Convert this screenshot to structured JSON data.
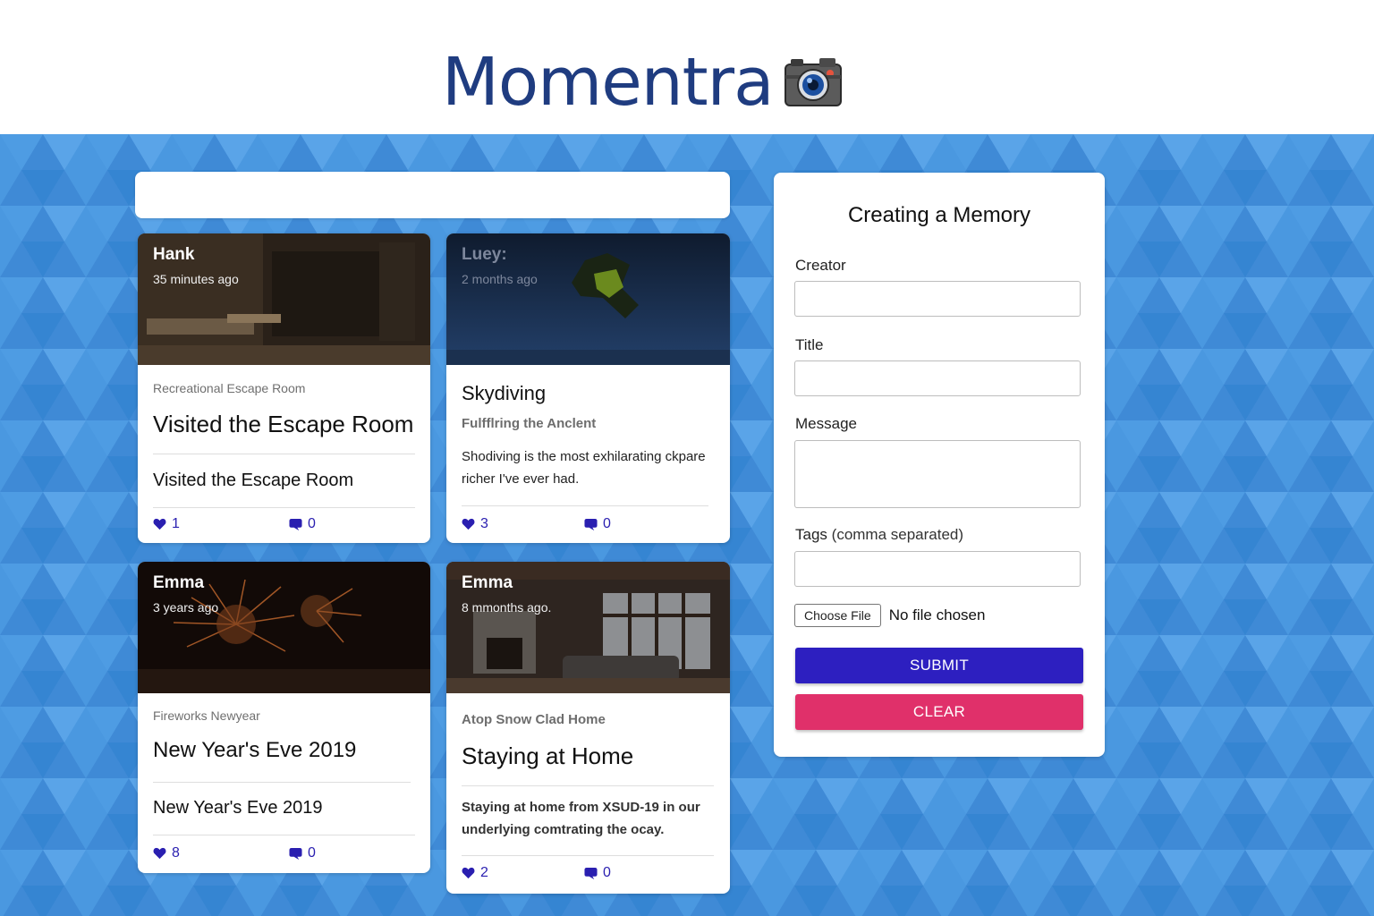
{
  "app": {
    "title": "Momentra",
    "logo_icon": "camera-icon"
  },
  "colors": {
    "brand": "#1f3c80",
    "background": "#4a98e0",
    "submit": "#2d1fc0",
    "clear": "#e0306a",
    "stat": "#2a1fb0"
  },
  "search": {
    "value": ""
  },
  "posts": [
    {
      "creator": "Hank",
      "time": "35 minutes ago",
      "tags": "Recreational Escape Room",
      "title": "Visited the Escape Room",
      "message": "Visited the Escape Room",
      "likes": "1",
      "comments": "0"
    },
    {
      "creator": "Luey:",
      "time": "2 months ago",
      "tags": "Skydiving",
      "title": "Fulfflring the Anclent",
      "message": "Shodiving is the most exhilarating ckpare richer I've ever had.",
      "likes": "3",
      "comments": "0"
    },
    {
      "creator": "Emma",
      "time": "3 years ago",
      "tags": "Fireworks Newyear",
      "title": "New Year's Eve 2019",
      "message": "New Year's Eve 2019",
      "likes": "8",
      "comments": "0"
    },
    {
      "creator": "Emma",
      "time": "8 mmonths ago.",
      "tags": "Atop Snow Clad Home",
      "title": "Staying at Home",
      "message": "Staying at home from XSUD-19 in our underlying comtrating the ocay.",
      "likes": "2",
      "comments": "0"
    }
  ],
  "form": {
    "heading": "Creating a Memory",
    "creator_label": "Creator",
    "title_label": "Title",
    "message_label": "Message",
    "tags_label": "Tags",
    "tags_hint": "(comma separated)",
    "file_button": "Choose File",
    "file_status": "No file chosen",
    "submit_label": "SUBMIT",
    "clear_label": "CLEAR"
  }
}
